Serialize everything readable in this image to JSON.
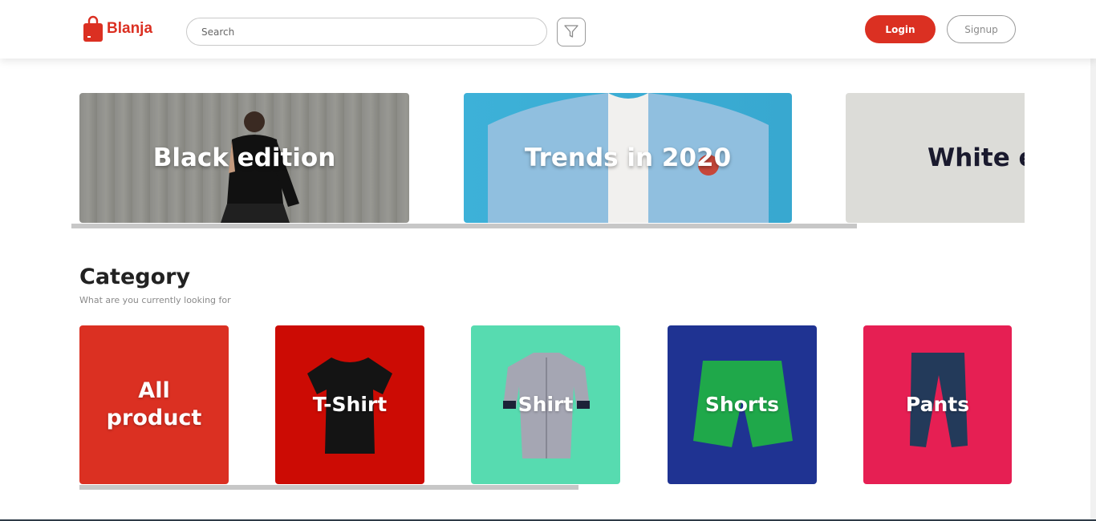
{
  "header": {
    "brand_name": "Blanja",
    "search_placeholder": "Search",
    "login_label": "Login",
    "signup_label": "Signup"
  },
  "banners": [
    {
      "title": "Black edition"
    },
    {
      "title": "Trends in 2020"
    },
    {
      "title": "White ed"
    }
  ],
  "category": {
    "title": "Category",
    "subtitle": "What are you currently looking for",
    "items": [
      {
        "label_line1": "All",
        "label_line2": "product",
        "color": "#db3022"
      },
      {
        "label": "T-Shirt",
        "color": "#cc0b04"
      },
      {
        "label": "Shirt",
        "color": "#57dbb0"
      },
      {
        "label": "Shorts",
        "color": "#1f3392"
      },
      {
        "label": "Pants",
        "color": "#e61f53"
      }
    ]
  },
  "colors": {
    "accent": "#db3022"
  },
  "icons": {
    "brand": "shopping-bag-icon",
    "filter": "funnel-icon"
  }
}
